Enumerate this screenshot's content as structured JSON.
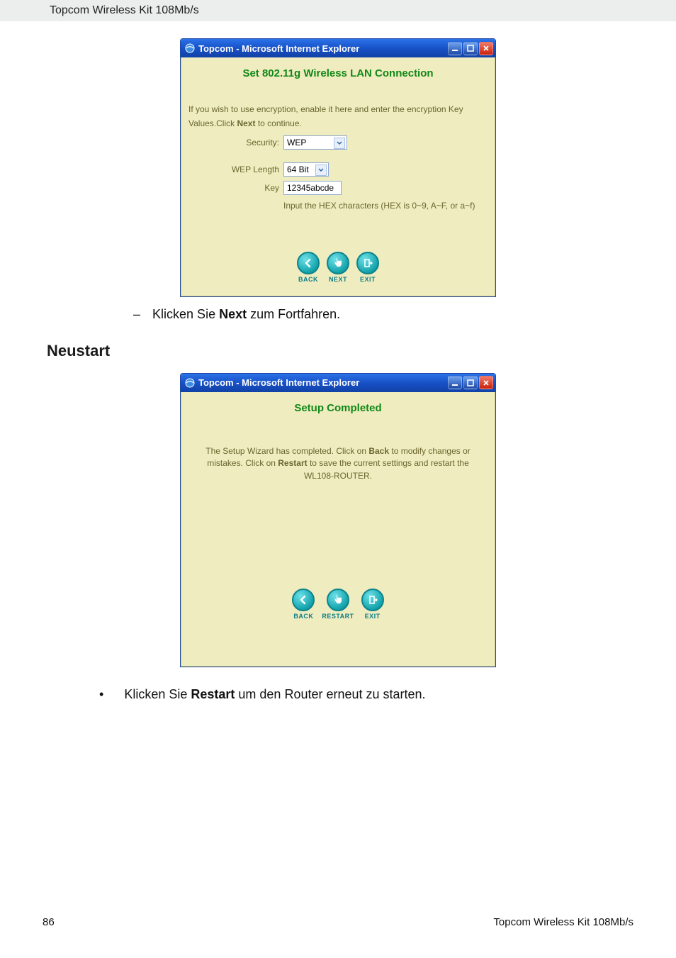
{
  "header": {
    "product": "Topcom Wireless Kit 108Mb/s"
  },
  "window": {
    "title": "Topcom - Microsoft Internet Explorer",
    "buttons": {
      "min_title": "minimize",
      "max_title": "maximize",
      "close_title": "close"
    }
  },
  "screen1": {
    "title": "Set 802.11g Wireless LAN Connection",
    "intro_before": "If you wish to use encryption, enable it here and enter the encryption Key Values.Click ",
    "intro_bold": "Next",
    "intro_after": " to continue.",
    "security_label": "Security:",
    "security_value": "WEP",
    "weplen_label": "WEP Length",
    "weplen_value": "64 Bit",
    "key_label": "Key",
    "key_value": "12345abcde",
    "hex_hint": "Input the HEX characters (HEX is 0~9, A~F, or a~f)",
    "nav": {
      "back": "BACK",
      "next": "NEXT",
      "exit": "EXIT"
    }
  },
  "doc": {
    "next_instruction_prefix": "Klicken Sie ",
    "next_instruction_bold": "Next",
    "next_instruction_suffix": " zum Fortfahren.",
    "restart_heading": "Neustart",
    "restart_instruction_prefix": "Klicken Sie ",
    "restart_instruction_bold": "Restart",
    "restart_instruction_suffix": " um den Router erneut zu starten."
  },
  "screen2": {
    "title": "Setup Completed",
    "body_p1_before": "The Setup Wizard has completed. Click on ",
    "body_p1_b1": "Back",
    "body_p1_mid": " to modify changes or mistakes. Click on ",
    "body_p1_b2": "Restart",
    "body_p1_after": " to save the current settings and restart the WL108-ROUTER.",
    "nav": {
      "back": "BACK",
      "restart": "RESTART",
      "exit": "EXIT"
    }
  },
  "footer": {
    "page": "86",
    "product": "Topcom Wireless Kit 108Mb/s"
  }
}
